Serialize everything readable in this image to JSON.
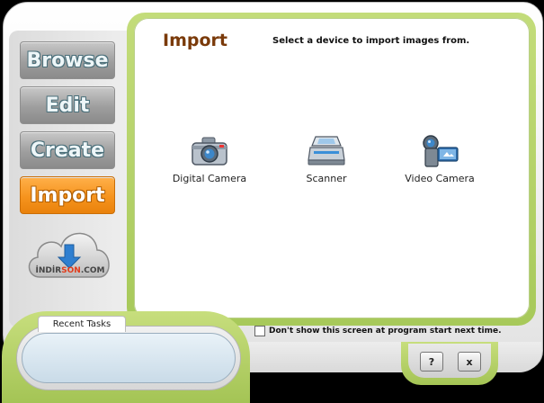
{
  "nav": {
    "items": [
      {
        "label": "Browse",
        "active": false
      },
      {
        "label": "Edit",
        "active": false
      },
      {
        "label": "Create",
        "active": false
      },
      {
        "label": "Import",
        "active": true
      }
    ]
  },
  "logo": {
    "text_main": "İNDİR",
    "text_accent": "SON",
    "text_tail": ".COM"
  },
  "main": {
    "title": "Import",
    "subtitle": "Select a device to import images from.",
    "devices": [
      {
        "label": "Digital Camera",
        "icon": "camera-icon"
      },
      {
        "label": "Scanner",
        "icon": "scanner-icon"
      },
      {
        "label": "Video Camera",
        "icon": "video-camera-icon"
      }
    ]
  },
  "recent": {
    "tab_label": "Recent Tasks"
  },
  "footer": {
    "checkbox_label": "Don't show this screen at program start next time.",
    "checkbox_checked": false,
    "help_label": "?",
    "close_label": "x"
  },
  "colors": {
    "accent_green": "#a7c95a",
    "active_orange": "#f6941e",
    "title_brown": "#7a3a0a"
  }
}
